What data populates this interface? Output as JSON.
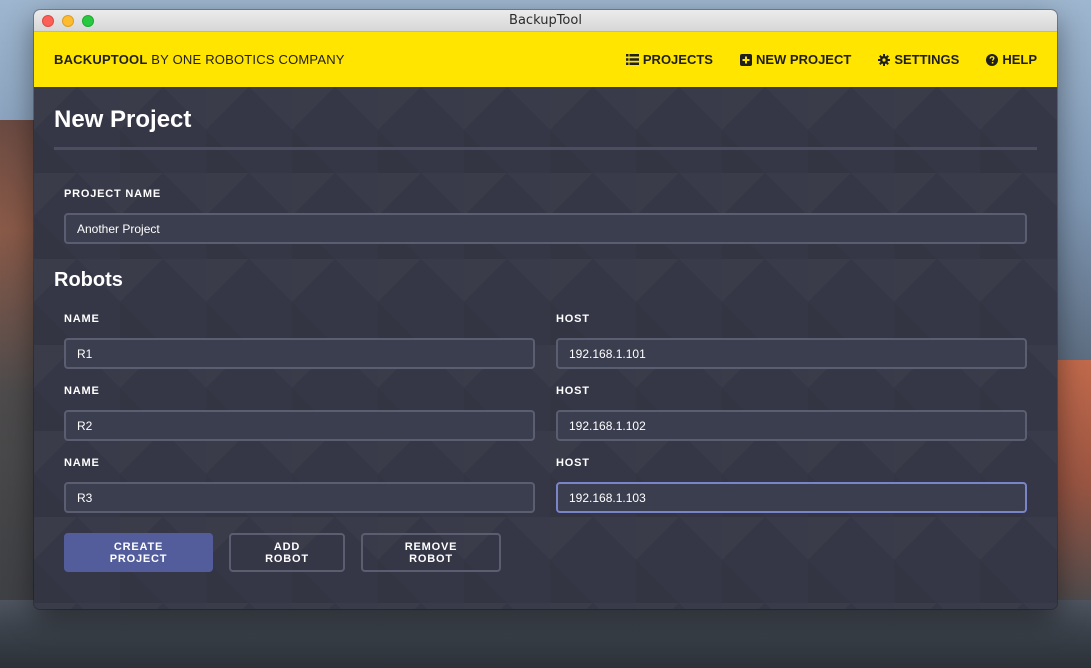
{
  "window": {
    "title": "BackupTool"
  },
  "navbar": {
    "brand_bold": "BACKUPTOOL",
    "brand_rest": "BY ONE ROBOTICS COMPANY",
    "links": [
      {
        "label": "PROJECTS",
        "icon": "list-icon"
      },
      {
        "label": "NEW PROJECT",
        "icon": "plus-square-icon"
      },
      {
        "label": "SETTINGS",
        "icon": "gear-icon"
      },
      {
        "label": "HELP",
        "icon": "question-circle-icon"
      }
    ],
    "color": "#ffe500"
  },
  "page": {
    "title": "New Project",
    "project_name_label": "PROJECT NAME",
    "project_name_value": "Another Project",
    "robots_title": "Robots"
  },
  "robots": [
    {
      "name_label": "NAME",
      "name": "R1",
      "host_label": "HOST",
      "host": "192.168.1.101"
    },
    {
      "name_label": "NAME",
      "name": "R2",
      "host_label": "HOST",
      "host": "192.168.1.102"
    },
    {
      "name_label": "NAME",
      "name": "R3",
      "host_label": "HOST",
      "host": "192.168.1.103"
    }
  ],
  "actions": {
    "create": "CREATE PROJECT",
    "add": "ADD ROBOT",
    "remove": "REMOVE ROBOT"
  },
  "colors": {
    "primary_button": "#535d9c",
    "background": "#353746",
    "focus_border": "#7a84c8"
  }
}
